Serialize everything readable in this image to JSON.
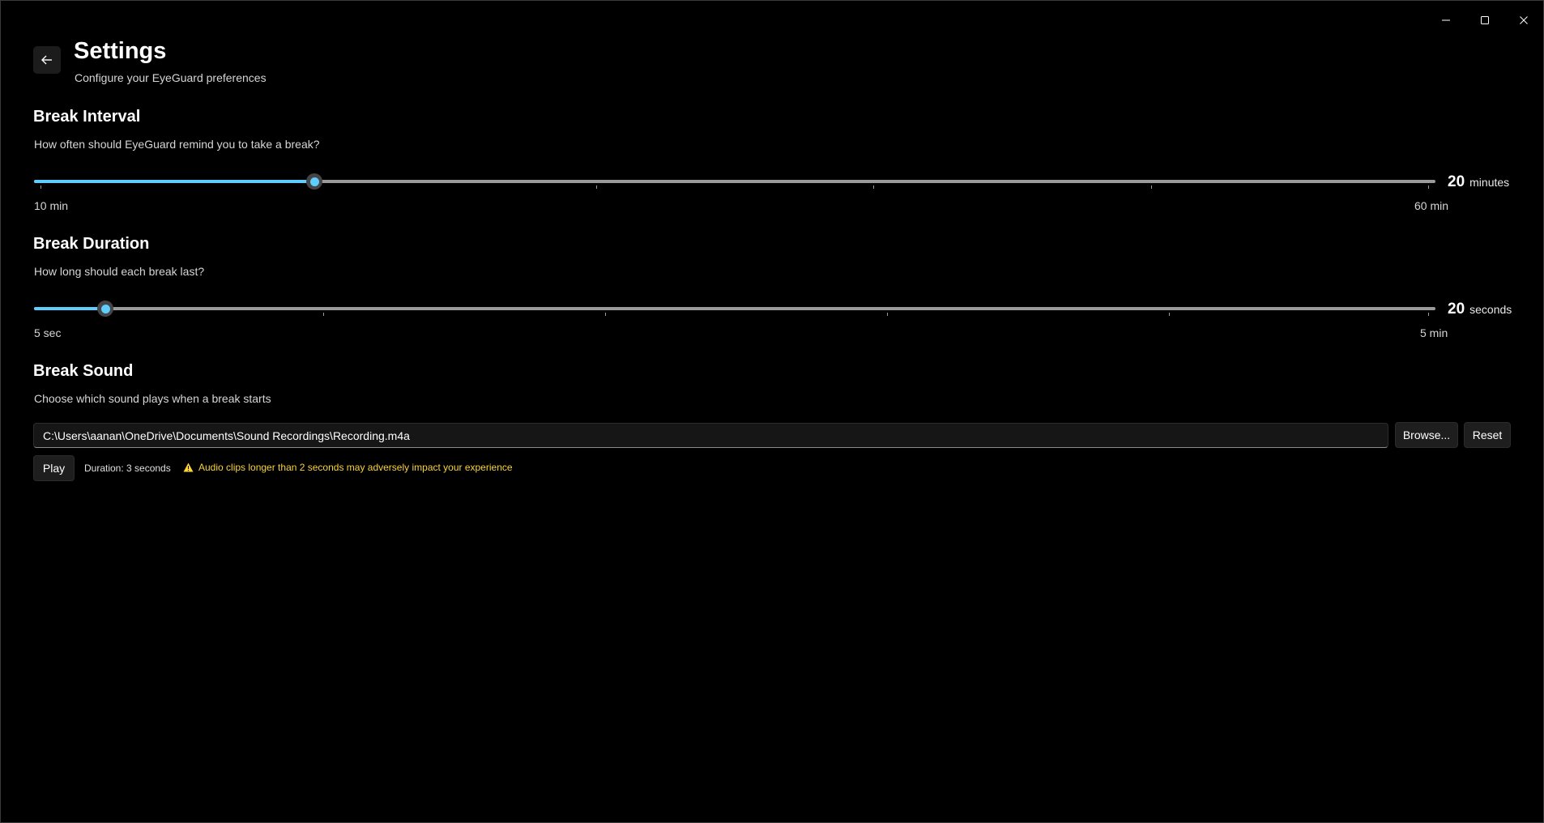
{
  "header": {
    "title": "Settings",
    "subtitle": "Configure your EyeGuard preferences"
  },
  "break_interval": {
    "title": "Break Interval",
    "description": "How often should EyeGuard remind you to take a break?",
    "min_label": "10 min",
    "max_label": "60 min",
    "min": 10,
    "max": 60,
    "value": 20,
    "value_text": "20",
    "unit": "minutes"
  },
  "break_duration": {
    "title": "Break Duration",
    "description": "How long should each break last?",
    "min_label": "5 sec",
    "max_label": "5 min",
    "min": 5,
    "max": 300,
    "value": 20,
    "value_text": "20",
    "unit": "seconds"
  },
  "break_sound": {
    "title": "Break Sound",
    "description": "Choose which sound plays when a break starts",
    "path": "C:\\Users\\aanan\\OneDrive\\Documents\\Sound Recordings\\Recording.m4a",
    "browse_label": "Browse...",
    "reset_label": "Reset",
    "play_label": "Play",
    "duration_text": "Duration: 3 seconds",
    "warning_text": "Audio clips longer than 2 seconds may adversely impact your experience"
  },
  "colors": {
    "accent": "#60cdff",
    "warning": "#f9d337",
    "background": "#000000"
  },
  "icons": {
    "back": "arrow-left-icon",
    "minimize": "minimize-icon",
    "maximize": "maximize-icon",
    "close": "close-icon",
    "warning": "warning-triangle-icon"
  }
}
